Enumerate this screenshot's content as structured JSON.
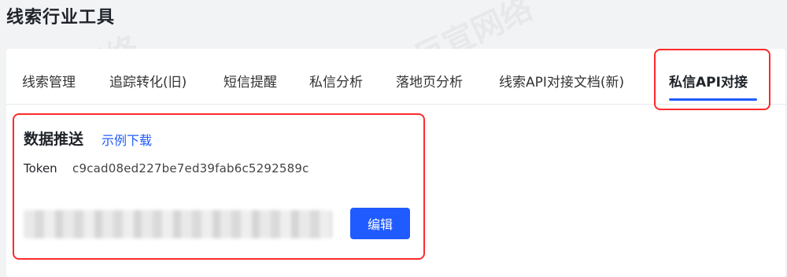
{
  "page": {
    "title": "线索行业工具"
  },
  "tabs": [
    {
      "label": "线索管理"
    },
    {
      "label": "追踪转化(旧)"
    },
    {
      "label": "短信提醒"
    },
    {
      "label": "私信分析"
    },
    {
      "label": "落地页分析"
    },
    {
      "label": "线索API对接文档(新)"
    },
    {
      "label": "私信API对接"
    }
  ],
  "active_tab": "私信API对接",
  "section": {
    "title": "数据推送",
    "download_link": "示例下载",
    "token_label": "Token",
    "token_value": "c9cad08ed227be7ed39fab6c5292589c",
    "edit_label": "编辑"
  },
  "watermark": {
    "text": "巨宣网络"
  },
  "colors": {
    "accent": "#1f5bff",
    "highlight": "#ff2a2a"
  }
}
